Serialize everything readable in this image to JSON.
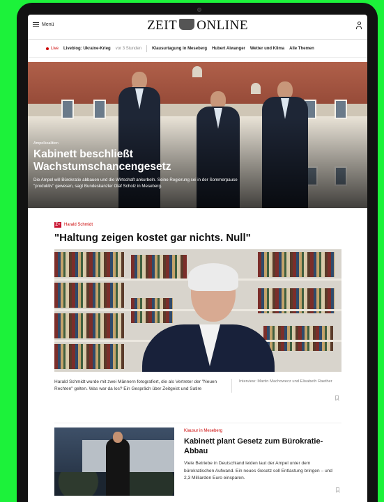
{
  "header": {
    "menu_label": "Menü",
    "logo_left": "ZEIT",
    "logo_right": "ONLINE"
  },
  "nav": {
    "live_label": "Live",
    "live_link": "Liveblog: Ukraine-Krieg",
    "live_time": "vor 3 Stunden",
    "topics": [
      "Klausurtagung in Meseberg",
      "Hubert Aiwanger",
      "Wetter und Klima",
      "Alle Themen"
    ]
  },
  "hero": {
    "kicker": "Ampelkoalition",
    "title": "Kabinett beschließt Wachstumschancengesetz",
    "lead": "Die Ampel will Bürokratie abbauen und die Wirtschaft ankurbeln. Seine Regierung sei in der Sommerpause \"produktiv\" gewesen, sagt Bundeskanzler Olaf Scholz in Meseberg."
  },
  "teaser1": {
    "badge": "Z+",
    "author": "Harald Schmidt",
    "title": "\"Haltung zeigen kostet gar nichts. Null\"",
    "lead": "Harald Schmidt wurde mit zwei Männern fotografiert, die als Vertreter der \"Neuen Rechten\" gelten. Was war da los? Ein Gespräch über Zeitgeist und Satire",
    "credit": "Interview: Martin Machowecz und Elisabeth Raether"
  },
  "teaser2": {
    "kicker": "Klausur in Meseberg",
    "title": "Kabinett plant Gesetz zum Bürokratie-Abbau",
    "lead": "Viele Betriebe in Deutschland leiden laut der Ampel unter dem bürokratischen Aufwand. Ein neues Gesetz soll Entlastung bringen – und 2,3 Milliarden Euro einsparen."
  },
  "colors": {
    "accent": "#cc0000",
    "device_bezel": "#121212",
    "background": "#1cf23a"
  },
  "icons": [
    "hamburger-icon",
    "user-icon",
    "live-dot-icon",
    "bookmark-icon"
  ]
}
